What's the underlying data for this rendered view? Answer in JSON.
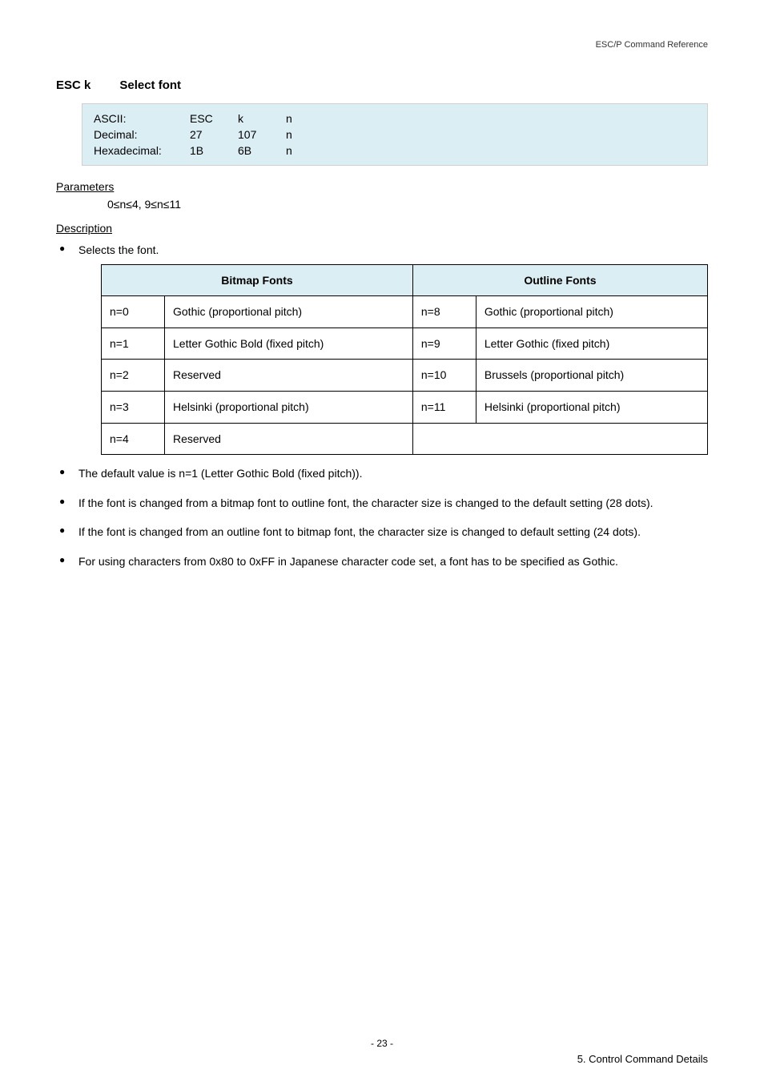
{
  "header": {
    "doc_ref": "ESC/P Command Reference"
  },
  "section": {
    "code": "ESC k",
    "title": "Select font"
  },
  "codeblock": {
    "rows": [
      {
        "label": "ASCII:",
        "c1": "ESC",
        "c2": "k",
        "c3": "n"
      },
      {
        "label": "Decimal:",
        "c1": "27",
        "c2": "107",
        "c3": "n"
      },
      {
        "label": "Hexadecimal:",
        "c1": "1B",
        "c2": "6B",
        "c3": "n"
      }
    ]
  },
  "parameters": {
    "heading": "Parameters",
    "line": "0≤n≤4, 9≤n≤11"
  },
  "description": {
    "heading": "Description",
    "selects": "Selects the font.",
    "table": {
      "headers": {
        "left": "Bitmap Fonts",
        "right": "Outline Fonts"
      },
      "rows": [
        {
          "ln": "n=0",
          "ld": "Gothic (proportional pitch)",
          "rn": "n=8",
          "rd": "Gothic (proportional pitch)"
        },
        {
          "ln": "n=1",
          "ld": "Letter Gothic Bold (fixed pitch)",
          "rn": "n=9",
          "rd": "Letter Gothic (fixed pitch)"
        },
        {
          "ln": "n=2",
          "ld": "Reserved",
          "rn": "n=10",
          "rd": "Brussels (proportional pitch)"
        },
        {
          "ln": "n=3",
          "ld": "Helsinki (proportional pitch)",
          "rn": "n=11",
          "rd": "Helsinki (proportional pitch)"
        },
        {
          "ln": "n=4",
          "ld": "Reserved",
          "rn": "",
          "rd": ""
        }
      ]
    },
    "bullets_after": [
      "The default value is n=1 (Letter Gothic Bold (fixed pitch)).",
      "If the font is changed from a bitmap font to outline font, the character size is changed to the default setting (28 dots).",
      "If the font is changed from an outline font to bitmap font, the character size is changed to default setting (24 dots).",
      "For using characters from 0x80 to 0xFF in Japanese character code set, a font has to be specified as Gothic."
    ]
  },
  "footer": {
    "page": "- 23 -",
    "section_ref": "5. Control Command Details"
  }
}
